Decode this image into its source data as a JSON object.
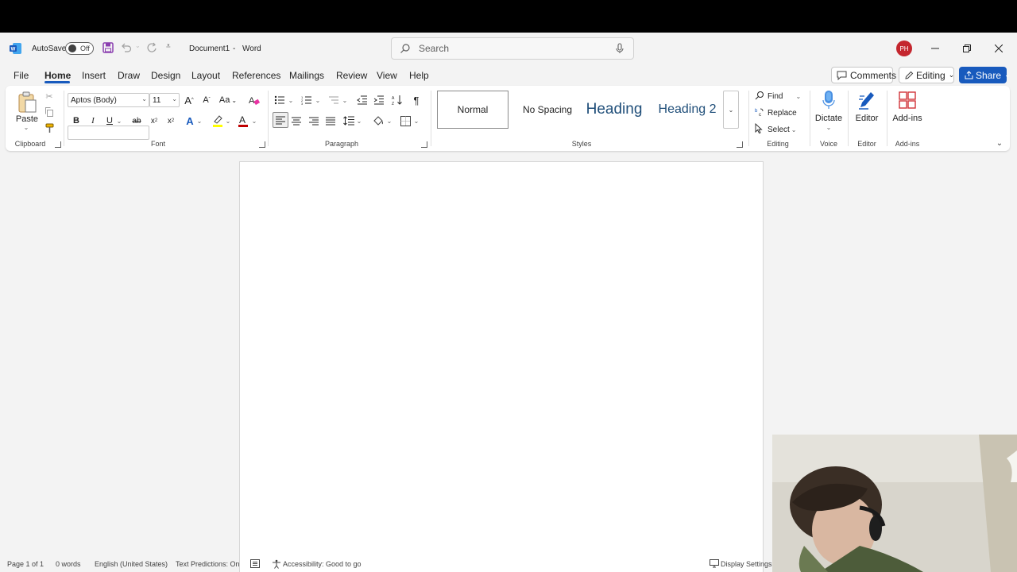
{
  "titlebar": {
    "autosave_label": "AutoSave",
    "autosave_state": "Off",
    "document_name": "Document1",
    "separator": "-",
    "app_name": "Word",
    "search_placeholder": "Search",
    "user_initials": "PH"
  },
  "tabs": [
    "File",
    "Home",
    "Insert",
    "Draw",
    "Design",
    "Layout",
    "References",
    "Mailings",
    "Review",
    "View",
    "Help"
  ],
  "active_tab": "Home",
  "header_buttons": {
    "comments": "Comments",
    "editing": "Editing",
    "share": "Share"
  },
  "ribbon": {
    "clipboard": {
      "paste": "Paste",
      "label": "Clipboard"
    },
    "font": {
      "name": "Aptos (Body)",
      "size": "11",
      "label": "Font",
      "change_case": "Aa"
    },
    "paragraph": {
      "label": "Paragraph"
    },
    "styles": {
      "items": [
        "Normal",
        "No Spacing",
        "Heading",
        "Heading 2"
      ],
      "label": "Styles"
    },
    "editing": {
      "find": "Find",
      "replace": "Replace",
      "select": "Select",
      "label": "Editing"
    },
    "voice": {
      "dictate": "Dictate",
      "label": "Voice"
    },
    "editor": {
      "editor": "Editor",
      "label": "Editor"
    },
    "addins": {
      "addins": "Add-ins",
      "label": "Add-ins"
    }
  },
  "statusbar": {
    "page": "Page 1 of 1",
    "words": "0 words",
    "language": "English (United States)",
    "predictions": "Text Predictions: On",
    "accessibility": "Accessibility: Good to go",
    "display_settings": "Display Settings"
  },
  "colors": {
    "accent": "#185abd",
    "highlight": "#ffff00",
    "font_color": "#c00000",
    "avatar": "#c4262e"
  }
}
